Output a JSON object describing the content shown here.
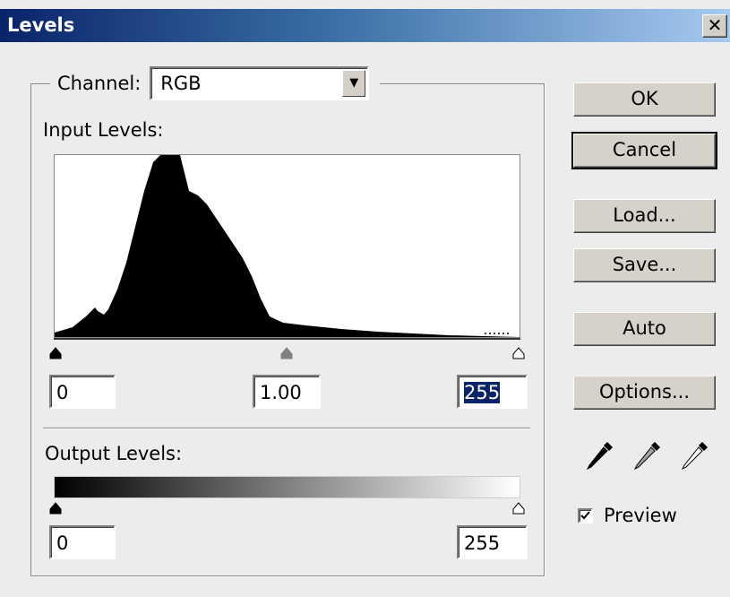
{
  "dialog": {
    "title": "Levels"
  },
  "channel": {
    "label": "Channel:",
    "value": "RGB"
  },
  "input_levels": {
    "label": "Input Levels:",
    "black": "0",
    "gamma": "1.00",
    "white": "255"
  },
  "output_levels": {
    "label": "Output Levels:",
    "black": "0",
    "white": "255"
  },
  "buttons": {
    "ok": "OK",
    "cancel": "Cancel",
    "load": "Load...",
    "save": "Save...",
    "auto": "Auto",
    "options": "Options..."
  },
  "preview": {
    "label": "Preview",
    "checked": true
  },
  "icons": {
    "close": "close-icon",
    "dropdown": "chevron-down-icon",
    "black_eyedropper": "eyedropper-black-icon",
    "gray_eyedropper": "eyedropper-gray-icon",
    "white_eyedropper": "eyedropper-white-icon"
  }
}
